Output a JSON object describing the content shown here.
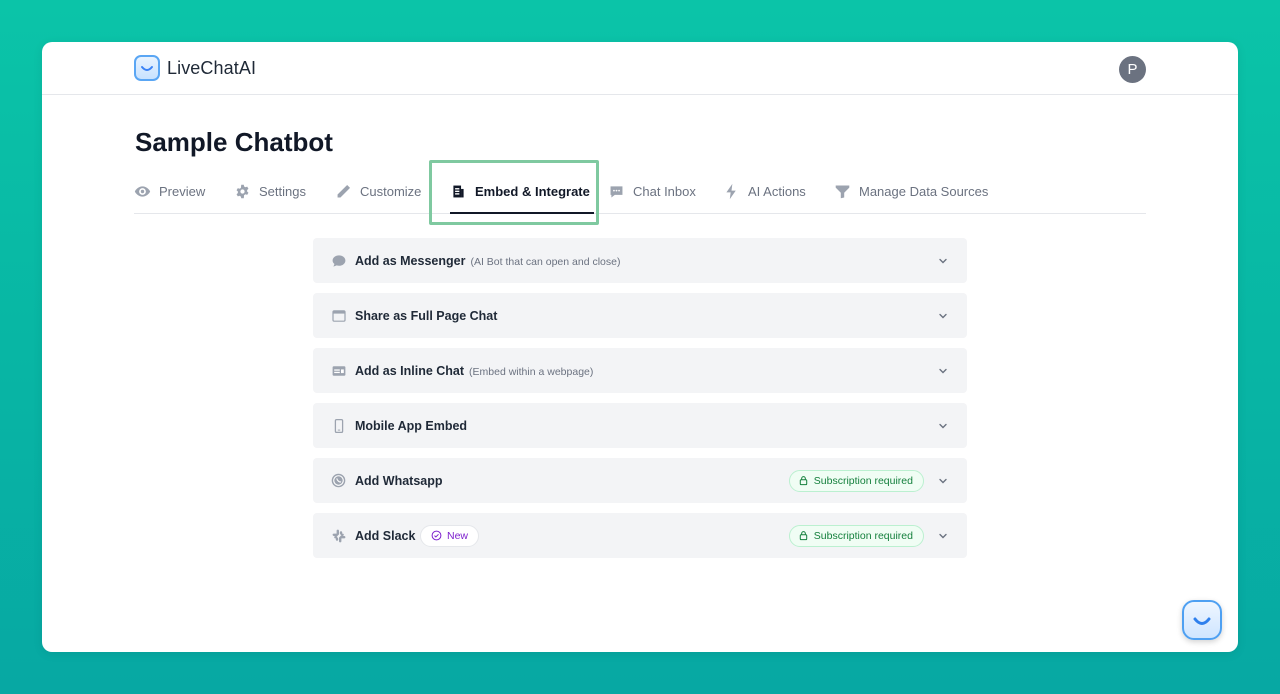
{
  "app": {
    "brand_name": "LiveChatAI",
    "avatar_initial": "P"
  },
  "page": {
    "title": "Sample Chatbot"
  },
  "tabs": [
    {
      "label": "Preview",
      "icon": "eye-icon",
      "active": false
    },
    {
      "label": "Settings",
      "icon": "gear-icon",
      "active": false
    },
    {
      "label": "Customize",
      "icon": "pencil-icon",
      "active": false
    },
    {
      "label": "Embed & Integrate",
      "icon": "document-icon",
      "active": true
    },
    {
      "label": "Chat Inbox",
      "icon": "chat-bubble-icon",
      "active": false
    },
    {
      "label": "AI Actions",
      "icon": "lightning-icon",
      "active": false
    },
    {
      "label": "Manage Data Sources",
      "icon": "funnel-icon",
      "active": false
    }
  ],
  "integrations": [
    {
      "label": "Add as Messenger",
      "sublabel": "(AI Bot that can open and close)",
      "icon": "speech-bubble-icon"
    },
    {
      "label": "Share as Full Page Chat",
      "sublabel": "",
      "icon": "browser-window-icon"
    },
    {
      "label": "Add as Inline Chat",
      "sublabel": "(Embed within a webpage)",
      "icon": "inline-embed-icon"
    },
    {
      "label": "Mobile App Embed",
      "sublabel": "",
      "icon": "mobile-phone-icon"
    },
    {
      "label": "Add Whatsapp",
      "sublabel": "",
      "icon": "whatsapp-icon",
      "badge": "Subscription required"
    },
    {
      "label": "Add Slack",
      "sublabel": "",
      "icon": "slack-icon",
      "new_badge": "New",
      "badge": "Subscription required"
    }
  ],
  "colors": {
    "background_gradient_top": "#0bc4a8",
    "background_gradient_bottom": "#07a8a3",
    "highlight_border": "#7fc9a0",
    "subscription_badge_text": "#15803d",
    "new_badge_text": "#7e22ce"
  }
}
